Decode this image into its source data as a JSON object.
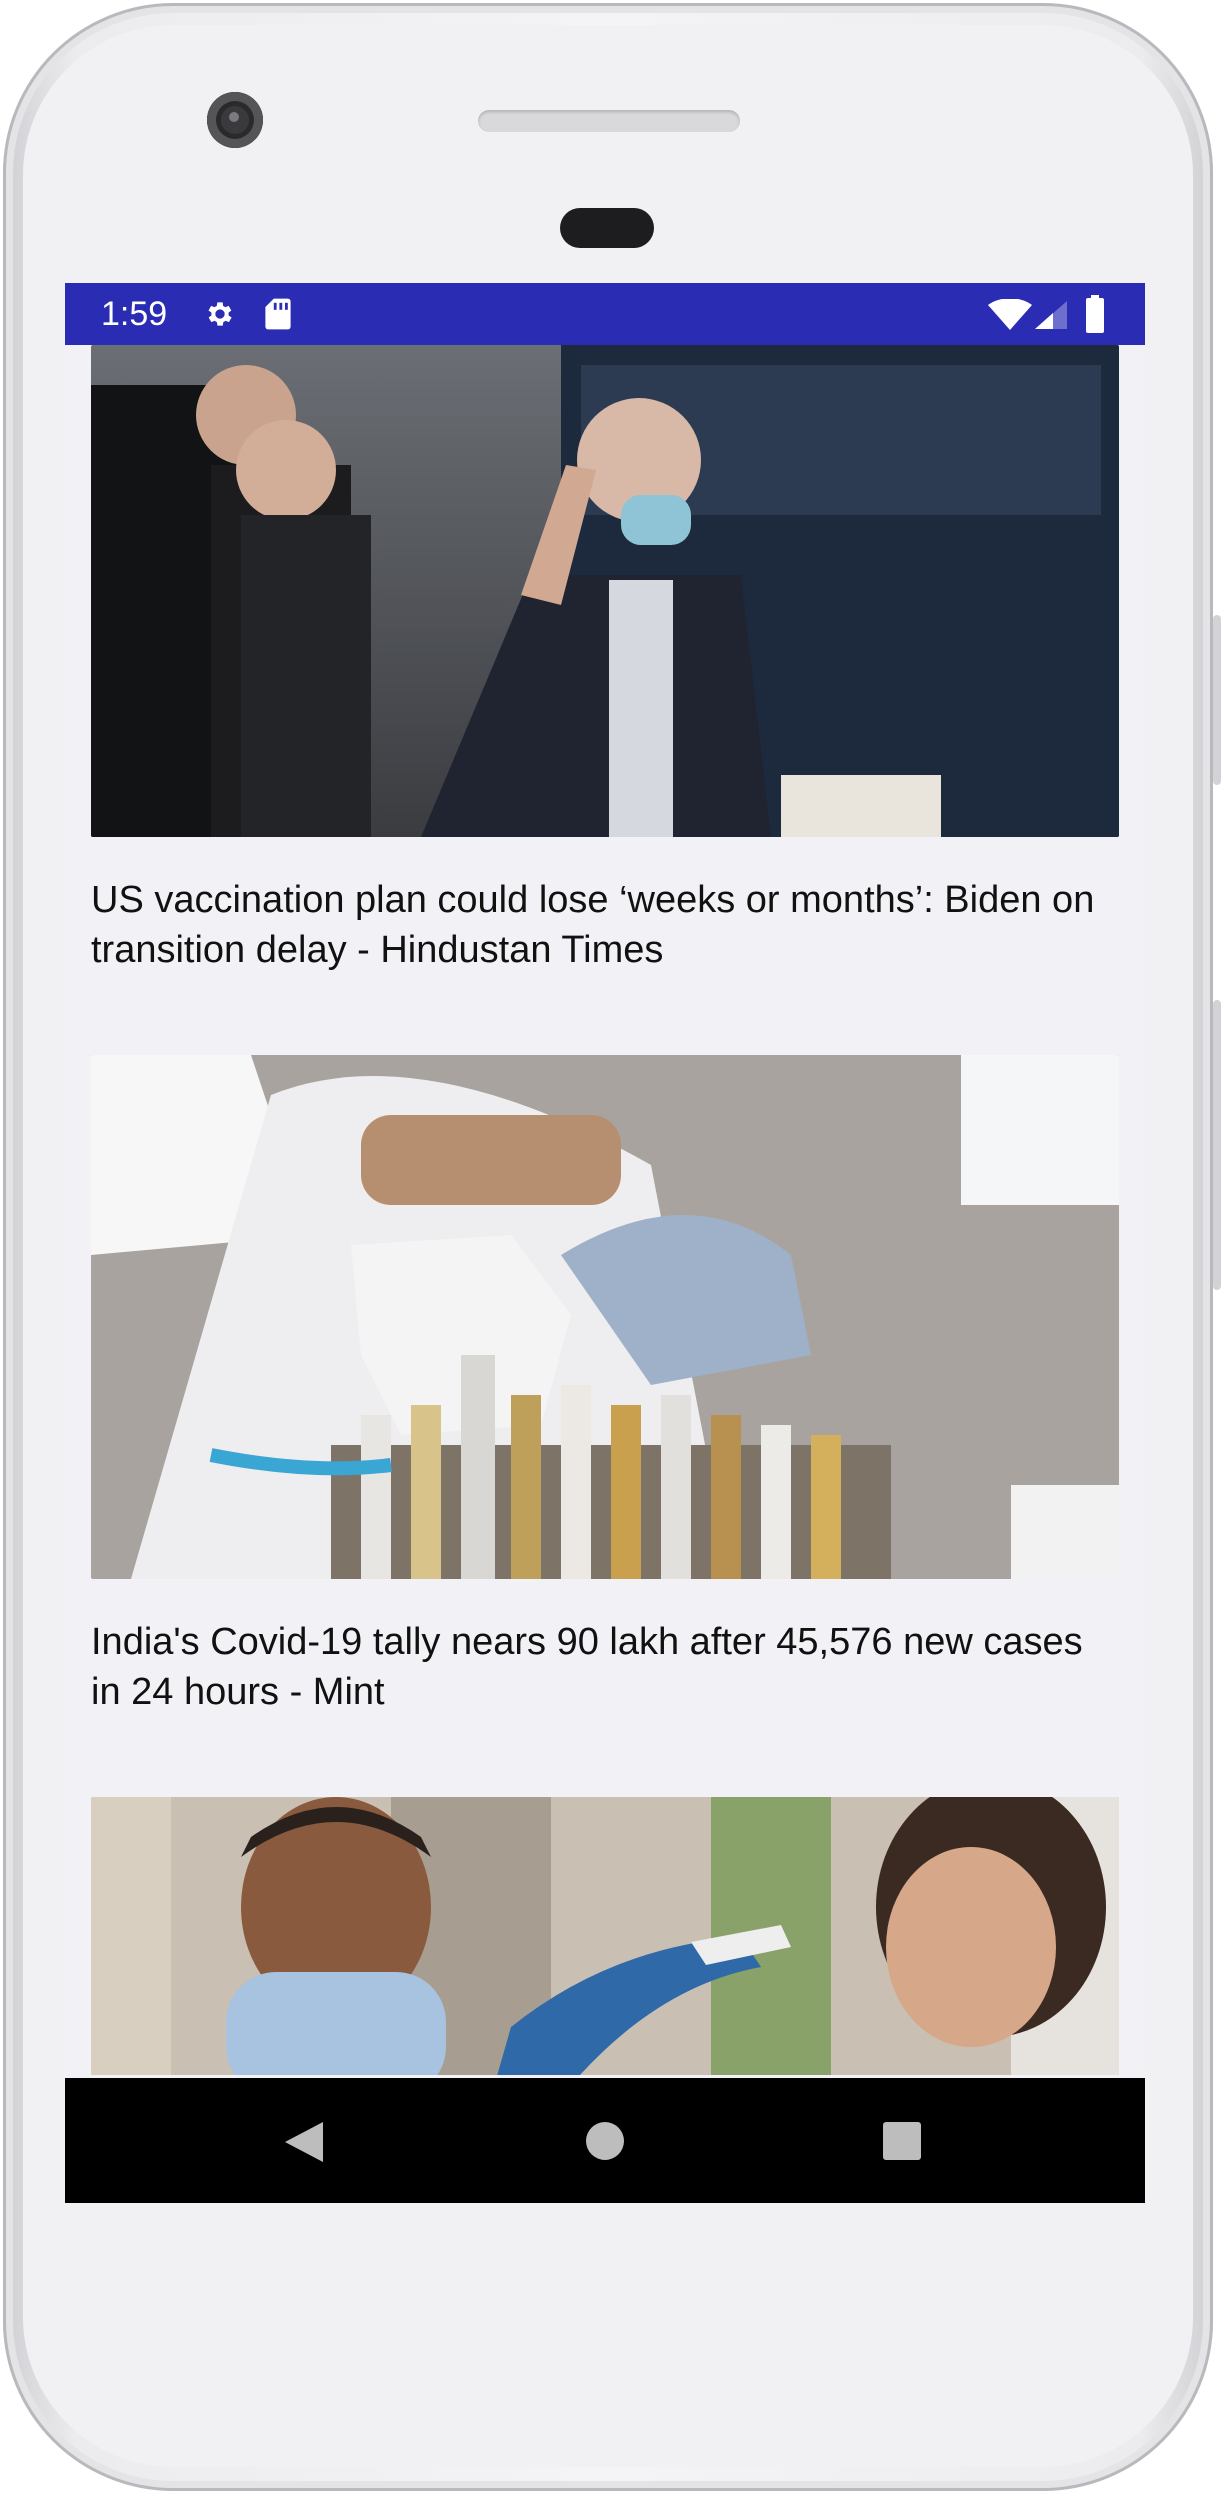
{
  "status_bar": {
    "time": "1:59",
    "icons": [
      "gear-icon",
      "sd-card-icon",
      "wifi-icon",
      "cell-signal-icon",
      "battery-icon"
    ],
    "background": "#2a2cb4"
  },
  "feed": {
    "articles": [
      {
        "title": "US vaccination plan could lose ‘weeks or months’: Biden on transition delay - Hindustan Times",
        "image": "photo-of-man-in-mask-waving"
      },
      {
        "title": "India's Covid-19 tally nears 90 lakh after 45,576 new cases in 24 hours - Mint",
        "image": "photo-of-health-worker-with-test-tubes"
      },
      {
        "title": "",
        "image": "photo-of-temperature-check"
      }
    ]
  },
  "nav_bar": {
    "buttons": [
      "back-icon",
      "home-icon",
      "recents-icon"
    ]
  }
}
